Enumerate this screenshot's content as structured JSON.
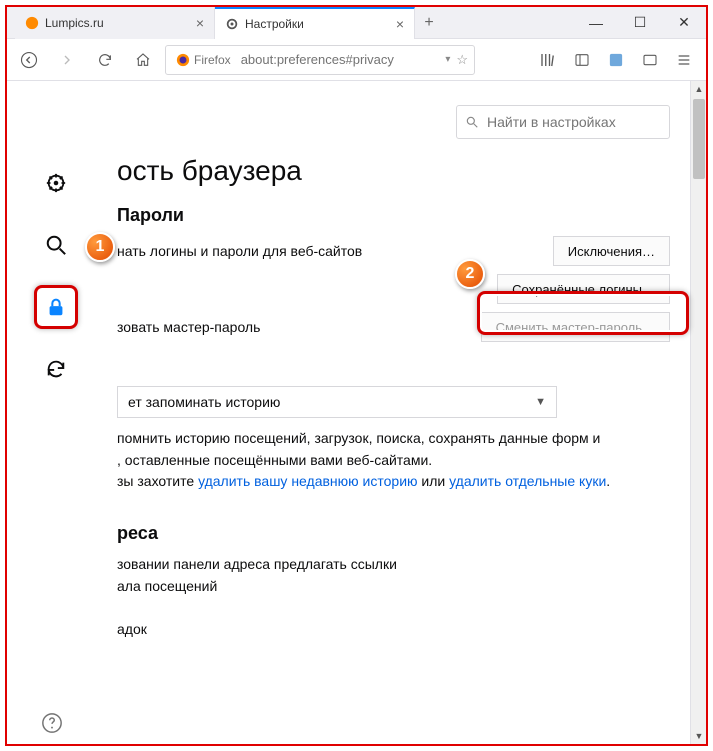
{
  "tabs": [
    {
      "label": "Lumpics.ru"
    },
    {
      "label": "Настройки"
    }
  ],
  "urlbar": {
    "badge": "Firefox",
    "url": "about:preferences#privacy"
  },
  "search": {
    "placeholder": "Найти в настройках"
  },
  "headings": {
    "security": "ость браузера",
    "passwords": "Пароли",
    "addresses": "реса"
  },
  "passwords": {
    "remember_label": "нать логины и пароли для веб-сайтов",
    "exceptions_btn": "Исключения…",
    "saved_btn": "Сохранённые логины…",
    "master_label": "зовать мастер-пароль",
    "change_master_btn": "Сменить мастер-пароль…"
  },
  "history": {
    "select_value": "ет запоминать историю",
    "para1": "помнить историю посещений, загрузок, поиска, сохранять данные форм и",
    "para1b": ", оставленные посещёнными вами веб-сайтами.",
    "para2_prefix": "зы захотите ",
    "para2_link1": "удалить вашу недавнюю историю",
    "para2_mid": " или ",
    "para2_link2": "удалить отдельные куки",
    "para2_suffix": "."
  },
  "addresses": {
    "line1": "зовании панели адреса предлагать ссылки",
    "line2": "ала посещений",
    "line3": "адок"
  },
  "markers": {
    "one": "1",
    "two": "2"
  }
}
